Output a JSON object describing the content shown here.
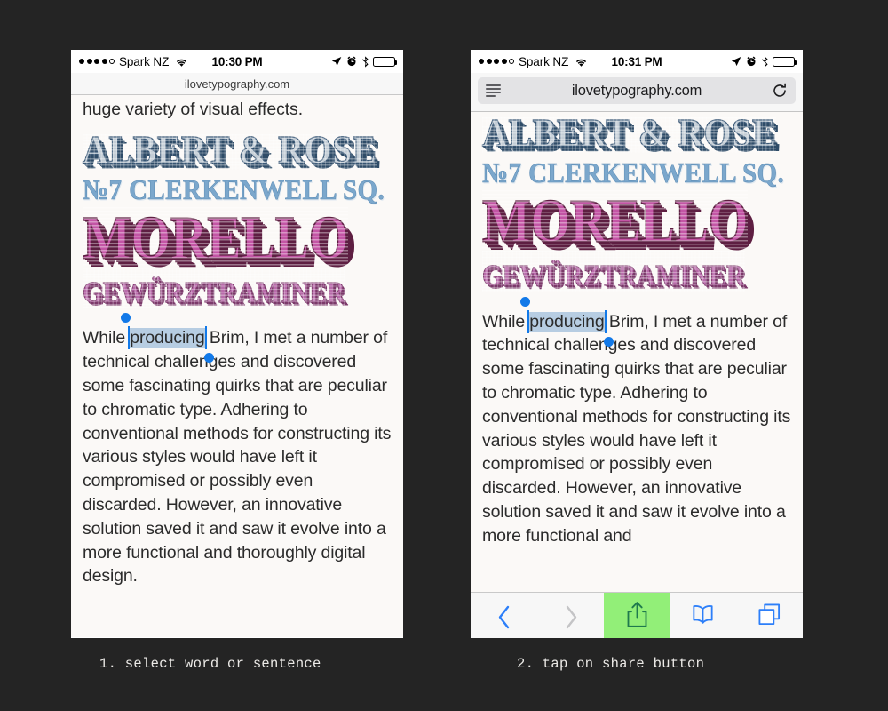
{
  "meta": {
    "background_color": "#242424",
    "accent_blue": "#1279e8",
    "selection_highlight": "#b7cde2",
    "share_highlight_green": "#92ef78"
  },
  "phone1": {
    "status": {
      "carrier": "Spark NZ",
      "time": "10:30 PM",
      "signal_filled": 4,
      "signal_empty": 1,
      "icons": [
        "wifi-icon",
        "location-arrow-icon",
        "alarm-clock-icon",
        "bluetooth-icon",
        "battery-icon"
      ]
    },
    "url": "ilovetypography.com",
    "lead_line": "huge variety of visual effects.",
    "poster": {
      "line1": "ALBERT & ROSE",
      "line2": "№7 CLERKENWELL SQ.",
      "line3": "MORELLO",
      "line4": "GEWÜRZTRAMINER"
    },
    "paragraph": {
      "before": "While ",
      "selected": "producing",
      "after": " Brim, I met a number of technical challenges and discovered some fascinating quirks that are peculiar to chromatic type. Adhering to conventional methods for constructing its various styles would have left it compromised or possibly even discarded. However, an innovative solution saved it and saw it evolve into a more functional and thoroughly digital design."
    }
  },
  "phone2": {
    "status": {
      "carrier": "Spark NZ",
      "time": "10:31 PM",
      "signal_filled": 4,
      "signal_empty": 1
    },
    "url": "ilovetypography.com",
    "chrome_icons": {
      "reader": "reader-mode-icon",
      "reload": "reload-icon"
    },
    "poster": {
      "line1": "ALBERT & ROSE",
      "line2": "№7 CLERKENWELL SQ.",
      "line3": "MORELLO",
      "line4": "GEWÜRZTRAMINER"
    },
    "paragraph": {
      "before": "While ",
      "selected": "producing",
      "after": " Brim, I met a number of technical challenges and discovered some fascinating quirks that are peculiar to chromatic type. Adhering to conventional methods for constructing its various styles would have left it compromised or possibly even discarded. However, an innovative solution saved it and saw it evolve into a more functional and"
    },
    "toolbar": {
      "back": "back-icon",
      "forward": "forward-icon",
      "share": "share-icon",
      "bookmarks": "bookmarks-icon",
      "tabs": "tabs-icon"
    }
  },
  "captions": {
    "step1": "1. select word or sentence",
    "step2": "2. tap on share button"
  }
}
